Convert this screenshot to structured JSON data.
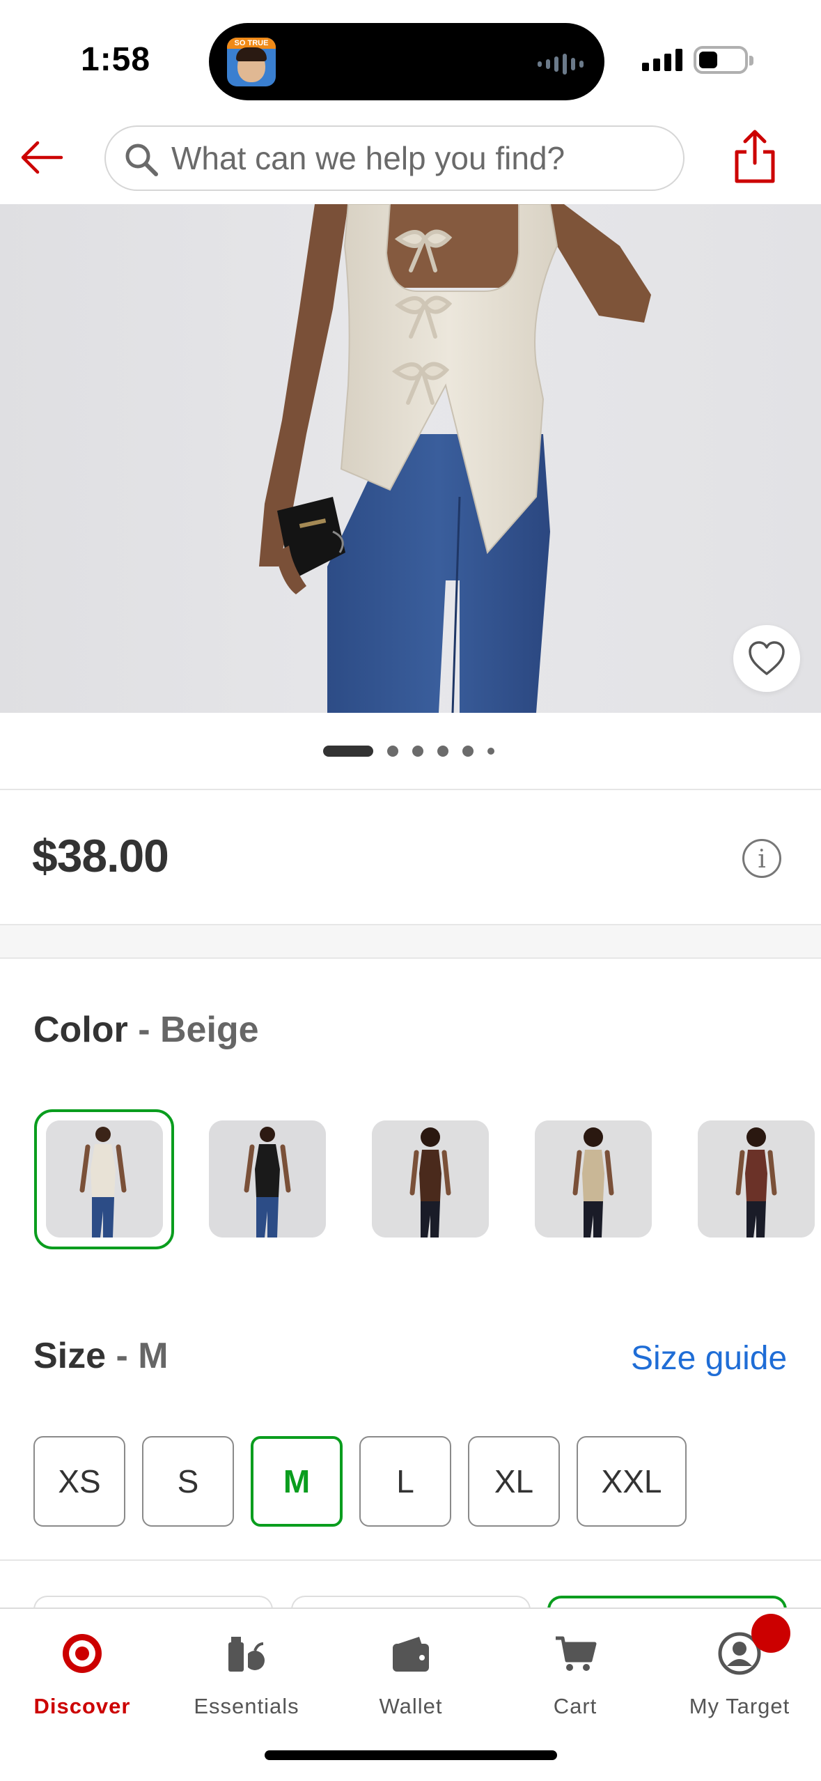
{
  "status_bar": {
    "time": "1:58",
    "island_app_badge": "SO TRUE"
  },
  "header": {
    "back_icon": "arrow-left-icon",
    "search_placeholder": "What can we help you find?",
    "share_icon": "share-icon"
  },
  "hero": {
    "carousel_dot_count": 6,
    "active_dot_index": 0
  },
  "product": {
    "price": "$38.00"
  },
  "color": {
    "label": "Color",
    "separator": "-",
    "selected": "Beige",
    "swatches": [
      "Beige",
      "Black",
      "Brown",
      "Khaki",
      "Burgundy"
    ],
    "selected_index": 0
  },
  "size": {
    "label": "Size",
    "separator": "-",
    "selected": "M",
    "guide_link": "Size guide",
    "options": [
      "XS",
      "S",
      "M",
      "L",
      "XL",
      "XXL"
    ],
    "selected_index": 2
  },
  "tabbar": {
    "tabs": [
      {
        "label": "Discover",
        "icon": "target-bullseye-icon",
        "active": true
      },
      {
        "label": "Essentials",
        "icon": "essentials-grocery-icon",
        "active": false
      },
      {
        "label": "Wallet",
        "icon": "wallet-icon",
        "active": false
      },
      {
        "label": "Cart",
        "icon": "cart-icon",
        "active": false
      },
      {
        "label": "My Target",
        "icon": "account-icon",
        "active": false
      }
    ]
  },
  "colors": {
    "brand_red": "#cc0000",
    "selection_green": "#0a9d1e",
    "link_blue": "#1f6dd6",
    "text": "#333333"
  }
}
